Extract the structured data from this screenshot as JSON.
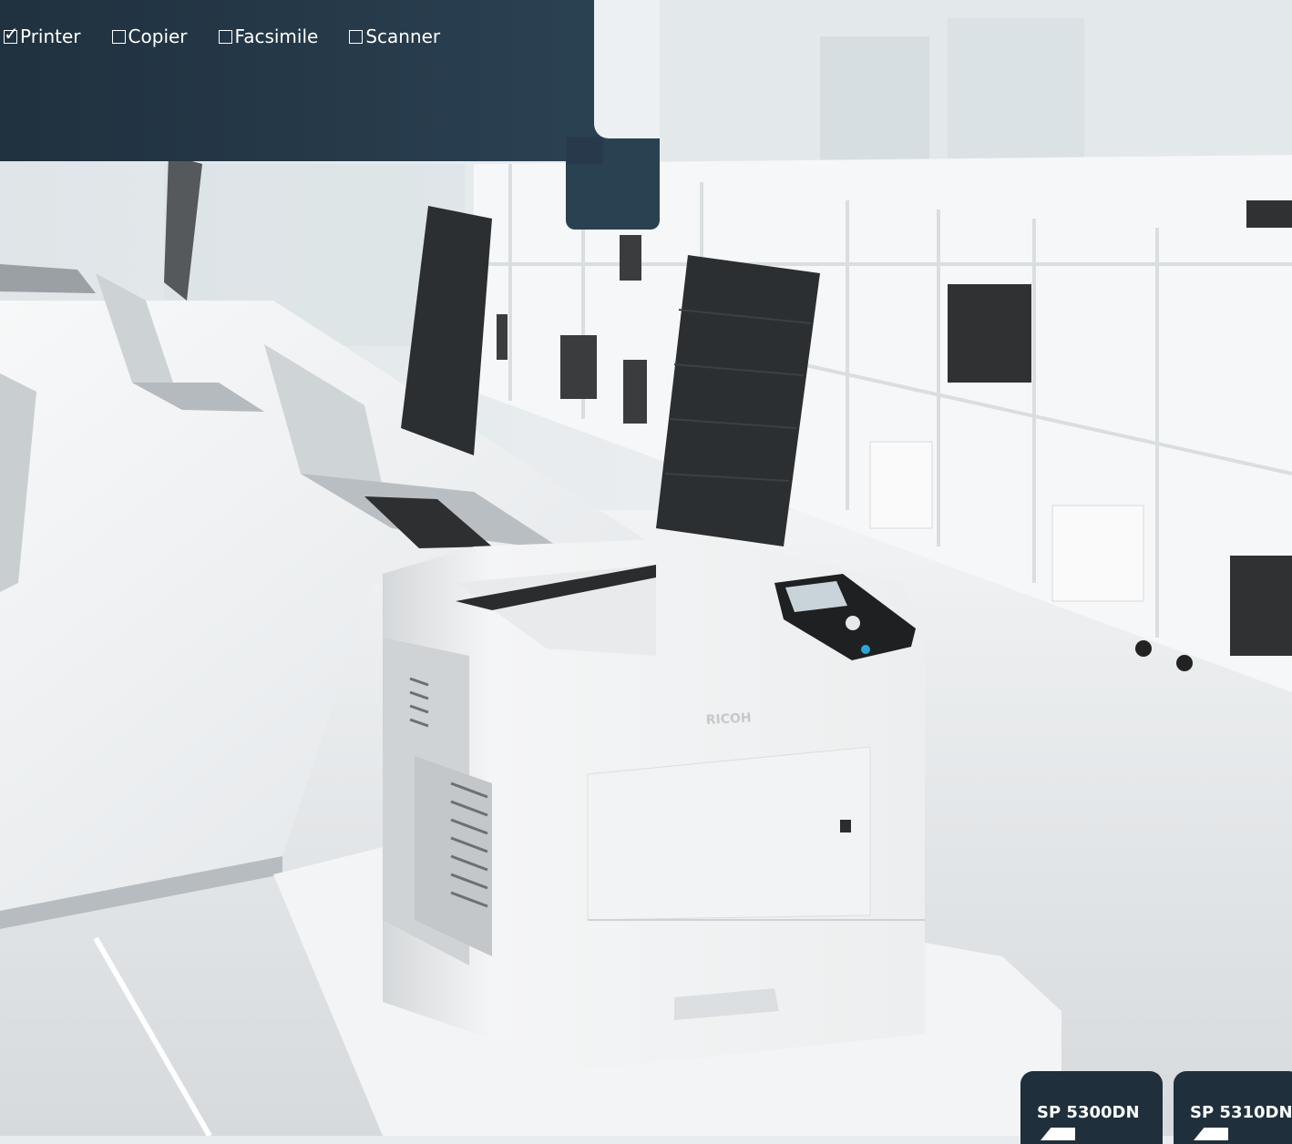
{
  "services": [
    {
      "label": "Printer",
      "checked": true
    },
    {
      "label": "Copier",
      "checked": false
    },
    {
      "label": "Facsimile",
      "checked": false
    },
    {
      "label": "Scanner",
      "checked": false
    }
  ],
  "models": [
    {
      "label": "SP 5300DN"
    },
    {
      "label": "SP 5310DN"
    }
  ],
  "printer_brand": "RICOH",
  "colors": {
    "panel": "#263a4a",
    "tab": "#1f2f3b"
  }
}
